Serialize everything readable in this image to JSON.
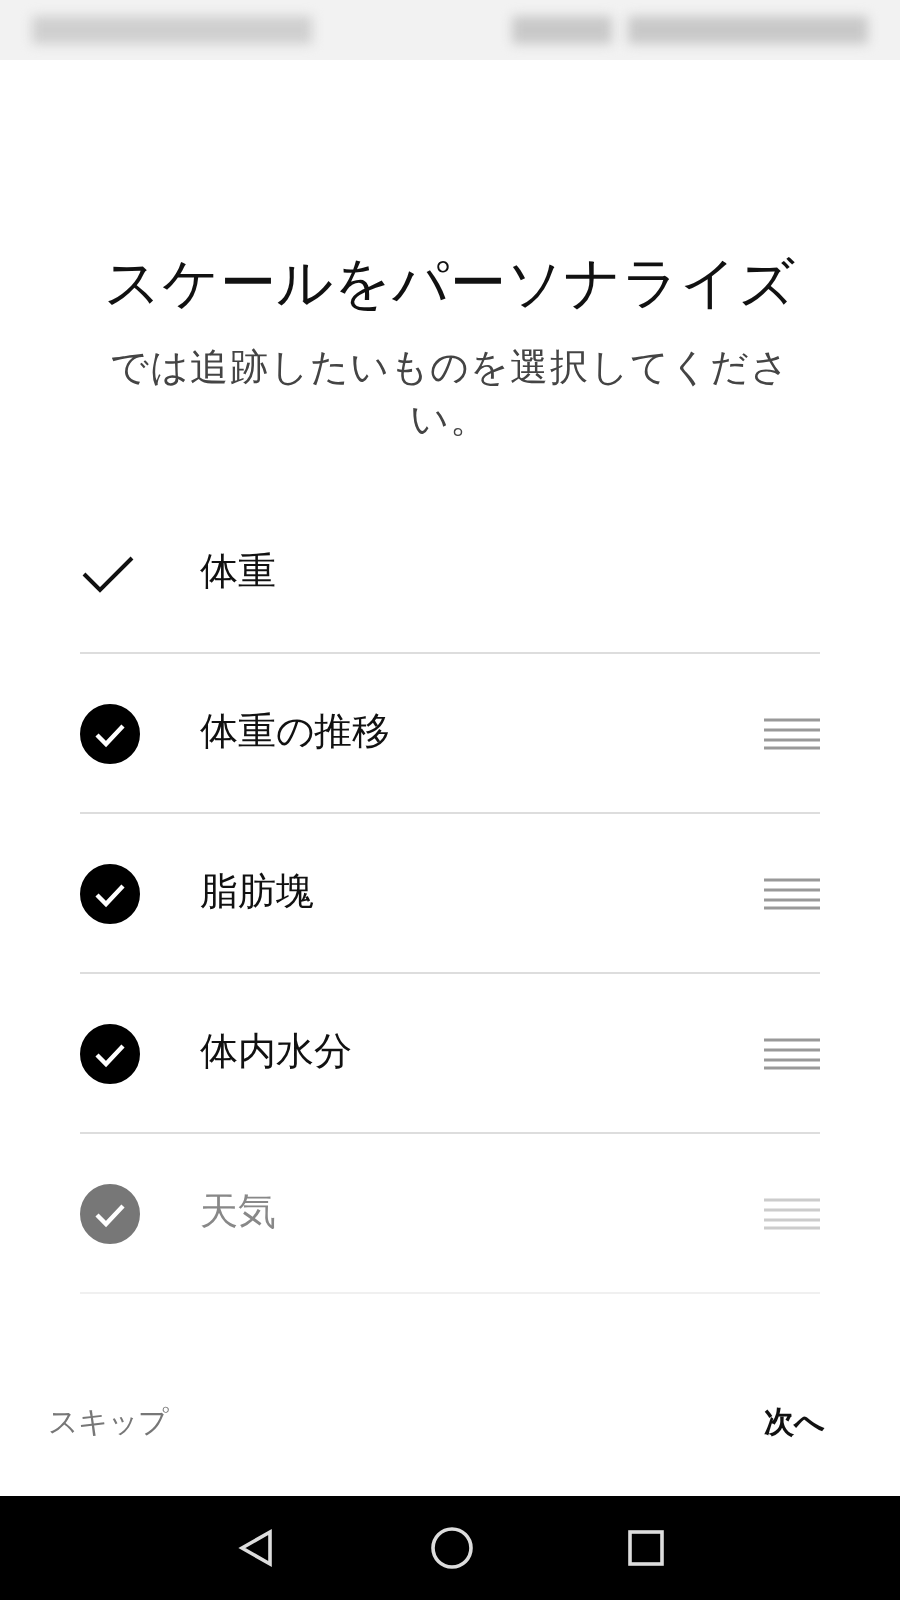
{
  "title": "スケールをパーソナライズ",
  "subtitle": "では追跡したいものを選択してください。",
  "items": [
    {
      "label": "体重",
      "kind": "fixed",
      "checked": true,
      "disabled": false
    },
    {
      "label": "体重の推移",
      "kind": "draggable",
      "checked": true,
      "disabled": false
    },
    {
      "label": "脂肪塊",
      "kind": "draggable",
      "checked": true,
      "disabled": false
    },
    {
      "label": "体内水分",
      "kind": "draggable",
      "checked": true,
      "disabled": false
    },
    {
      "label": "天気",
      "kind": "draggable",
      "checked": true,
      "disabled": true
    }
  ],
  "footer": {
    "skip": "スキップ",
    "next": "次へ"
  }
}
